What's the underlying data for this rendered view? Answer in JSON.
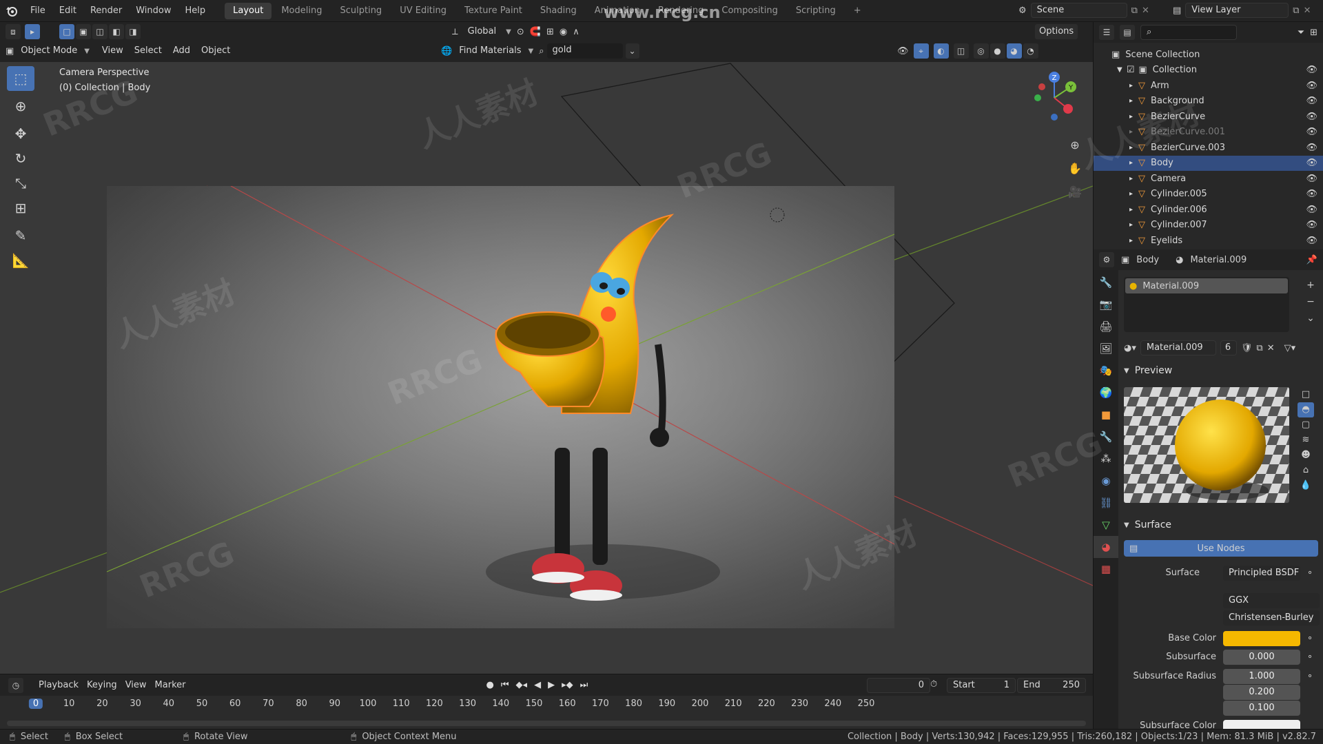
{
  "topbar": {
    "menus": [
      "File",
      "Edit",
      "Render",
      "Window",
      "Help"
    ],
    "workspaces": [
      "Layout",
      "Modeling",
      "Sculpting",
      "UV Editing",
      "Texture Paint",
      "Shading",
      "Animation",
      "Rendering",
      "Compositing",
      "Scripting"
    ],
    "active_workspace": "Layout",
    "add_tab": "+",
    "scene": "Scene",
    "view_layer": "View Layer",
    "site_watermark": "www.rrcg.cn"
  },
  "viewport_header": {
    "mode": "Object Mode",
    "menus": [
      "View",
      "Select",
      "Add",
      "Object"
    ],
    "orientation": "Global",
    "options": "Options",
    "find_materials": "Find Materials",
    "search_value": "gold"
  },
  "viewport": {
    "camera_label": "Camera Perspective",
    "collection_label": "(0) Collection | Body",
    "gizmo_axes": [
      "Z",
      "Y"
    ]
  },
  "outliner": {
    "root": "Scene Collection",
    "collection": "Collection",
    "items": [
      {
        "name": "Arm",
        "selected": false,
        "dim": false
      },
      {
        "name": "Background",
        "selected": false,
        "dim": false
      },
      {
        "name": "BezierCurve",
        "selected": false,
        "dim": false
      },
      {
        "name": "BezierCurve.001",
        "selected": false,
        "dim": true
      },
      {
        "name": "BezierCurve.003",
        "selected": false,
        "dim": false
      },
      {
        "name": "Body",
        "selected": true,
        "dim": false
      },
      {
        "name": "Camera",
        "selected": false,
        "dim": false
      },
      {
        "name": "Cylinder.005",
        "selected": false,
        "dim": false
      },
      {
        "name": "Cylinder.006",
        "selected": false,
        "dim": false
      },
      {
        "name": "Cylinder.007",
        "selected": false,
        "dim": false
      },
      {
        "name": "Eyelids",
        "selected": false,
        "dim": false
      }
    ]
  },
  "properties": {
    "object": "Body",
    "material": "Material.009",
    "slot": "Material.009",
    "datablock": "Material.009",
    "user_count": "6",
    "preview_label": "Preview",
    "surface_panel": "Surface",
    "use_nodes": "Use Nodes",
    "surface_label": "Surface",
    "surface_value": "Principled BSDF",
    "distribution": "GGX",
    "subsurface_method": "Christensen-Burley",
    "base_color_label": "Base Color",
    "base_color": "#f5b800",
    "subsurface_label": "Subsurface",
    "subsurface_value": "0.000",
    "subsurface_radius_label": "Subsurface Radius",
    "subsurface_radius": [
      "1.000",
      "0.200",
      "0.100"
    ],
    "subsurface_color_label": "Subsurface Color"
  },
  "timeline": {
    "menus": [
      "Playback",
      "Keying",
      "View",
      "Marker"
    ],
    "current_frame": "0",
    "start_label": "Start",
    "start_value": "1",
    "end_label": "End",
    "end_value": "250",
    "frames": [
      "0",
      "10",
      "20",
      "30",
      "40",
      "50",
      "60",
      "70",
      "80",
      "90",
      "100",
      "110",
      "120",
      "130",
      "140",
      "150",
      "160",
      "170",
      "180",
      "190",
      "200",
      "210",
      "220",
      "230",
      "240",
      "250"
    ]
  },
  "statusbar": {
    "select": "Select",
    "box_select": "Box Select",
    "rotate_view": "Rotate View",
    "context_menu": "Object Context Menu",
    "stats": "Collection | Body | Verts:130,942 | Faces:129,955 | Tris:260,182 | Objects:1/23 | Mem: 81.3 MiB | v2.82.7"
  },
  "watermarks": [
    "RRCG",
    "人人素材",
    "人人素材"
  ],
  "colors": {
    "accent": "#4772b3",
    "selection": "#334d80",
    "character": "#e8b400"
  }
}
